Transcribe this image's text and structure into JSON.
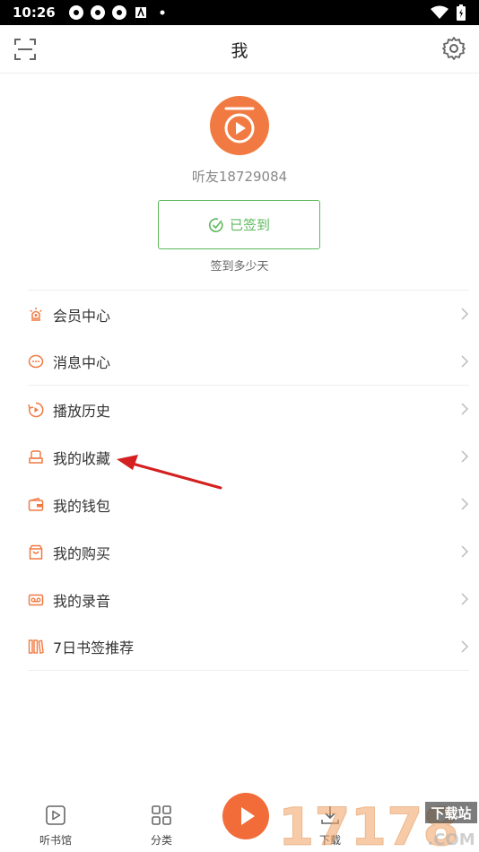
{
  "status_bar": {
    "time": "10:26"
  },
  "header": {
    "title": "我"
  },
  "profile": {
    "username": "听友18729084",
    "signin_label": "已签到",
    "signin_sub": "签到多少天"
  },
  "menu": {
    "items": [
      {
        "label": "会员中心",
        "icon": "vip-crown-icon"
      },
      {
        "label": "消息中心",
        "icon": "message-bubble-icon"
      },
      {
        "label": "播放历史",
        "icon": "history-play-icon"
      },
      {
        "label": "我的收藏",
        "icon": "favorites-icon"
      },
      {
        "label": "我的钱包",
        "icon": "wallet-icon"
      },
      {
        "label": "我的购买",
        "icon": "shopping-bag-icon"
      },
      {
        "label": "我的录音",
        "icon": "recording-tape-icon"
      },
      {
        "label": "7日书签推荐",
        "icon": "bookshelf-icon"
      }
    ]
  },
  "tabbar": {
    "tabs": [
      {
        "label": "听书馆"
      },
      {
        "label": "分类"
      },
      {
        "label": "下载"
      }
    ]
  },
  "watermark": {
    "text": "17178",
    "badge": "下载站",
    "suffix": ".COM"
  },
  "colors": {
    "accent": "#f17a42",
    "signed": "#5cb85c",
    "arrow": "#e02020"
  }
}
